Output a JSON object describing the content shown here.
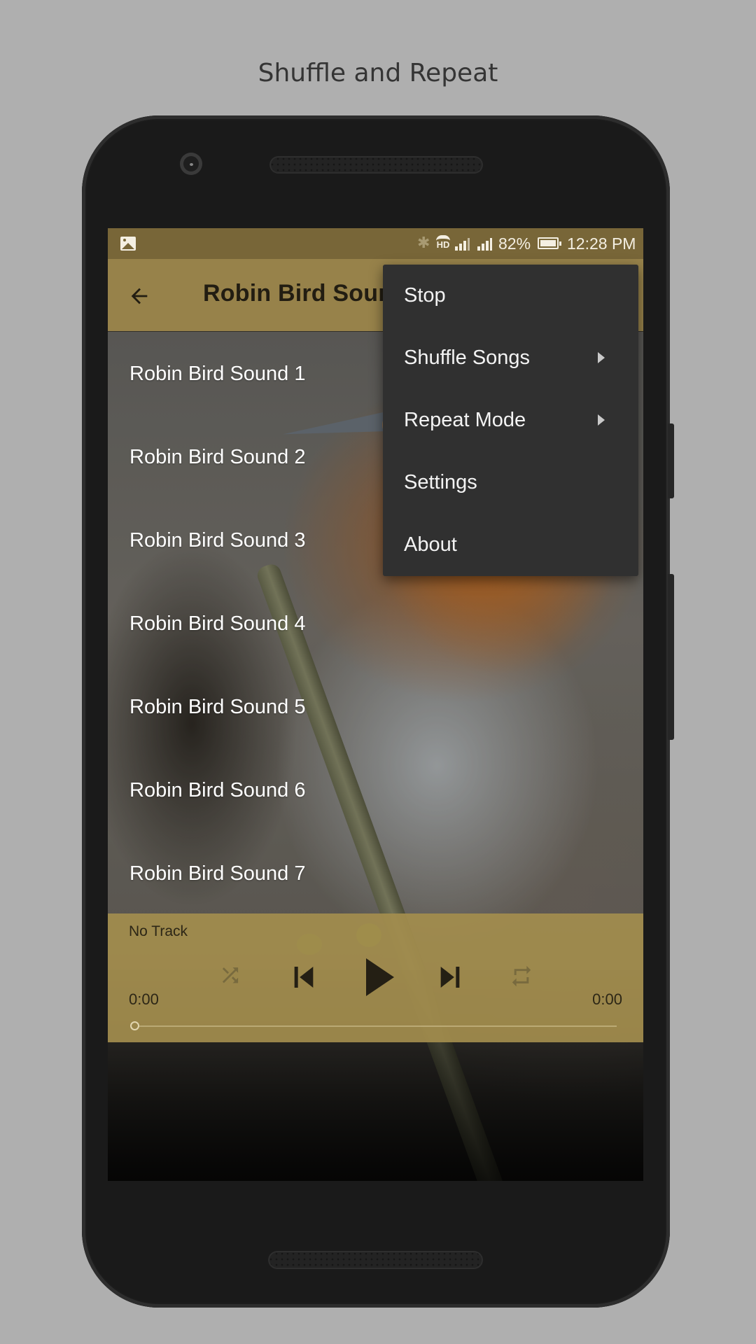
{
  "caption": "Shuffle and Repeat",
  "status_bar": {
    "left_icon": "gallery-notification-icon",
    "icons": [
      "bluetooth-icon",
      "hd-voice-icon",
      "signal-icon",
      "signal-icon",
      "battery-icon"
    ],
    "battery_percent": "82%",
    "time": "12:28 PM"
  },
  "app_bar": {
    "back_icon": "arrow-left-icon",
    "title": "Robin Bird Sounds"
  },
  "tracks": [
    {
      "label": "Robin Bird Sound 1"
    },
    {
      "label": "Robin Bird Sound 2"
    },
    {
      "label": "Robin Bird Sound 3"
    },
    {
      "label": "Robin Bird Sound 4"
    },
    {
      "label": "Robin Bird Sound 5"
    },
    {
      "label": "Robin Bird Sound 6"
    },
    {
      "label": "Robin Bird Sound 7"
    }
  ],
  "player": {
    "now_playing": "No Track",
    "time_elapsed": "0:00",
    "time_total": "0:00",
    "progress": 0,
    "controls": {
      "shuffle": {
        "icon": "shuffle-icon",
        "enabled": false
      },
      "previous": {
        "icon": "skip-previous-icon",
        "enabled": true
      },
      "play": {
        "icon": "play-icon",
        "enabled": true
      },
      "next": {
        "icon": "skip-next-icon",
        "enabled": true
      },
      "repeat": {
        "icon": "repeat-icon",
        "enabled": false
      }
    }
  },
  "menu": {
    "items": [
      {
        "label": "Stop",
        "has_submenu": false
      },
      {
        "label": "Shuffle Songs",
        "has_submenu": true
      },
      {
        "label": "Repeat Mode",
        "has_submenu": true
      },
      {
        "label": "Settings",
        "has_submenu": false
      },
      {
        "label": "About",
        "has_submenu": false
      }
    ]
  },
  "colors": {
    "status_bar": "#786638",
    "app_bar": "#97824a",
    "player_panel": "#a38d4e",
    "menu_background": "#303030",
    "page_background": "#afafaf"
  }
}
